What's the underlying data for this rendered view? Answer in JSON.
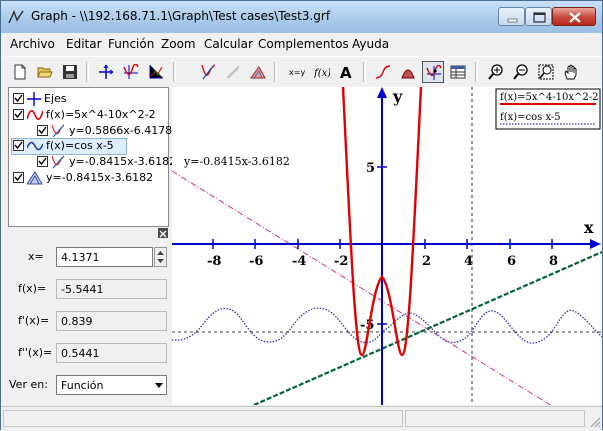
{
  "window": {
    "title": "Graph - \\\\192.168.71.1\\Graph\\Test cases\\Test3.grf"
  },
  "menu": [
    "Archivo",
    "Editar",
    "Función",
    "Zoom",
    "Calcular",
    "Complementos",
    "Ayuda"
  ],
  "toolbar_icons": [
    "new-file-icon",
    "open-folder-icon",
    "save-icon",
    "axes-icon",
    "insert-function-icon",
    "insert-point-series-icon",
    "tangent-icon",
    "shading-icon",
    "relation-icon",
    "text-label-icon",
    "custom-function-icon",
    "font-icon",
    "trace-icon",
    "area-icon",
    "evaluate-icon",
    "table-icon",
    "zoom-in-icon",
    "zoom-out-icon",
    "zoom-fit-icon",
    "pan-hand-icon"
  ],
  "tree": {
    "items": [
      {
        "label": "Ejes",
        "level": 0
      },
      {
        "label": "f(x)=5x^4-10x^2-2",
        "level": 0
      },
      {
        "label": "y=0.5866x-6.4178",
        "level": 1
      },
      {
        "label": "f(x)=cos x-5",
        "level": 0,
        "selected": true
      },
      {
        "label": "y=-0.8415x-3.6182",
        "level": 1
      },
      {
        "label": "y=-0.8415x-3.6182",
        "level": 0
      }
    ]
  },
  "evaluate": {
    "x_label": "x=",
    "x_value": "4.1371",
    "fx_label": "f(x)=",
    "fx_value": "-5.5441",
    "f1_label": "f'(x)=",
    "f1_value": "0.839",
    "f2_label": "f''(x)=",
    "f2_value": "0.5441",
    "view_label": "Ver en:",
    "view_value": "Función"
  },
  "graph": {
    "axis_x_label": "x",
    "axis_y_label": "y",
    "x_ticks": [
      "-8",
      "-6",
      "-4",
      "-2",
      "2",
      "4",
      "6",
      "8"
    ],
    "y_ticks": [
      "5",
      "-5"
    ],
    "tangent_label": "y=-0.8415x-3.6182",
    "legend": [
      "f(x)=5x^4-10x^2-2",
      "f(x)=cos x-5"
    ],
    "colors": {
      "axes": "#0000cc",
      "quartic": "#e00000",
      "cosine": "#3030c0",
      "tangent1": "#006633",
      "tangent2": "#cc3399"
    }
  }
}
